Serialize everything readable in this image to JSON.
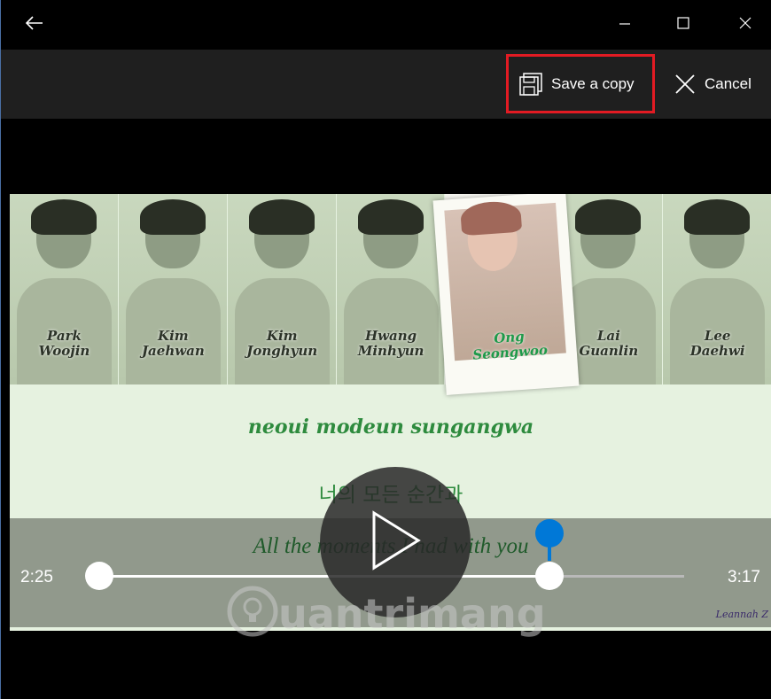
{
  "titlebar": {
    "back_icon": "arrow-left-icon",
    "window_controls": [
      "minimize-icon",
      "maximize-icon",
      "close-icon"
    ]
  },
  "toolbar": {
    "save_label": "Save a copy",
    "cancel_label": "Cancel",
    "save_icon": "save-copy-icon",
    "cancel_icon": "close-icon",
    "highlight_color": "#e21b23"
  },
  "video": {
    "members": [
      {
        "first": "Park",
        "last": "Woojin"
      },
      {
        "first": "Kim",
        "last": "Jaehwan"
      },
      {
        "first": "Kim",
        "last": "Jonghyun"
      },
      {
        "first": "Hwang",
        "last": "Minhyun"
      },
      {
        "first": "Ong",
        "last": "Seongwoo"
      },
      {
        "first": "Lai",
        "last": "Guanlin"
      },
      {
        "first": "Lee",
        "last": "Daehwi"
      }
    ],
    "lyric_romanized": "neoui modeun sungangwa",
    "lyric_korean": "너의 모든 순간과",
    "lyric_english": "All the moments I had with you",
    "credit": "Leannah Z"
  },
  "player": {
    "start_time": "2:25",
    "end_time": "3:17",
    "position_fraction": 0.77,
    "accent_color": "#0078d7"
  },
  "watermark": {
    "text": "uantrimang"
  }
}
